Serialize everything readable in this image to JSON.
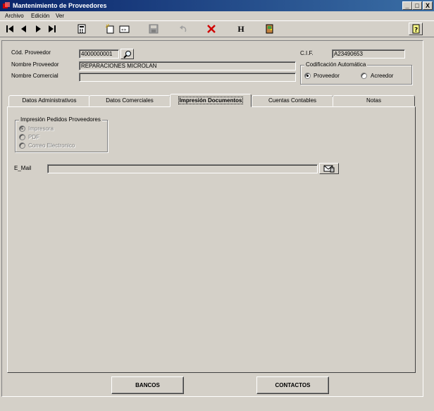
{
  "window": {
    "title": "Mantenimiento de Proveedores",
    "min": "_",
    "max": "□",
    "close": "X"
  },
  "menu": {
    "items": [
      "Archivo",
      "Edición",
      "Ver"
    ]
  },
  "header": {
    "cod_label": "Cód. Proveedor",
    "cod_value": "4000000001",
    "nombre_label": "Nombre Proveedor",
    "nombre_value": "REPARACIONES MICROLAN",
    "comercial_label": "Nombre Comercial",
    "comercial_value": "",
    "cif_label": "C.I.F.",
    "cif_value": "A23490653",
    "codif_title": "Codificación Automática",
    "codif_opt1": "Proveedor",
    "codif_opt2": "Acreedor"
  },
  "tabs": [
    "Datos Administrativos",
    "Datos Comerciales",
    "Impresión Documentos",
    "Cuentas Contables",
    "Notas"
  ],
  "impresion": {
    "group_title": "Impresión Pedidos Proveedores",
    "opt1": "Impresora",
    "opt2": "PDF",
    "opt3": "Correo Electronico",
    "email_label": "E_Mail",
    "email_value": ""
  },
  "footer": {
    "bancos": "BANCOS",
    "contactos": "CONTACTOS"
  }
}
